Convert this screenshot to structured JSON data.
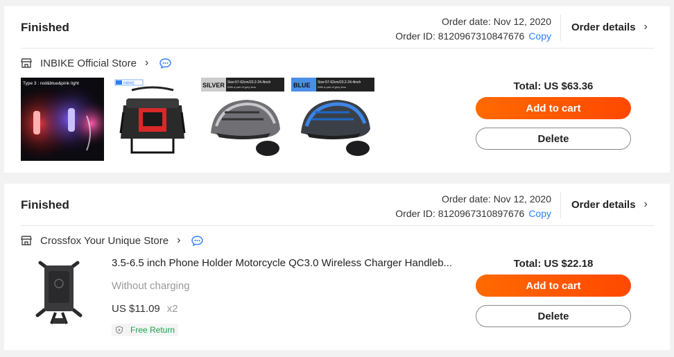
{
  "orders": [
    {
      "status": "Finished",
      "order_date": "Order date: Nov 12, 2020",
      "order_id": "Order ID: 8120967310847676",
      "copy_label": "Copy",
      "details_label": "Order details",
      "store_name": "INBIKE Official Store",
      "total": "Total: US $63.36",
      "add_to_cart": "Add to cart",
      "delete": "Delete",
      "thumbnails": [
        {
          "caption": "Type 3 : red&blue&pink light"
        },
        {
          "caption": "INBIKE"
        },
        {
          "tag": "SILVER",
          "size": "Size:57-62cm/23.2-24.4inch",
          "note": "With a pair of grey lens"
        },
        {
          "tag": "BLUE",
          "size": "Size:57-62cm/23.2-24.4inch",
          "note": "With a pair of grey lens"
        }
      ]
    },
    {
      "status": "Finished",
      "order_date": "Order date: Nov 12, 2020",
      "order_id": "Order ID: 8120967310897676",
      "copy_label": "Copy",
      "details_label": "Order details",
      "store_name": "Crossfox Your Unique Store",
      "total": "Total: US $22.18",
      "add_to_cart": "Add to cart",
      "delete": "Delete",
      "product": {
        "title": "3.5-6.5 inch Phone Holder Motorcycle QC3.0 Wireless Charger Handleb...",
        "sku": "Without charging",
        "price": "US $11.09",
        "qty": "x2",
        "badge": "Free Return"
      }
    }
  ],
  "colors": {
    "accent": "#ff5500",
    "link": "#2e7cf6",
    "green": "#1a9f4c"
  },
  "icons": [
    "shop-icon",
    "chevron-right-icon",
    "chat-icon",
    "shield-icon"
  ]
}
